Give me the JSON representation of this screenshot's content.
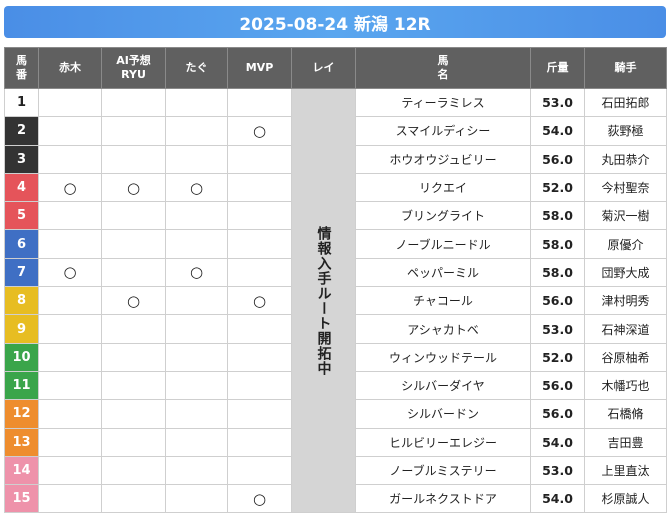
{
  "header": {
    "title": "2025-08-24 新潟 12R"
  },
  "columns": {
    "umaban": "馬\n番",
    "akagi": "赤木",
    "ai": "AI予想\nRYU",
    "tagu": "たぐ",
    "mvp": "MVP",
    "rei": "レイ",
    "bamei": "馬\n名",
    "kinryo": "斤量",
    "kishu": "騎手"
  },
  "rei_note": "情報入手ルート開拓中",
  "mark_symbol": "○",
  "rows": [
    {
      "num": "1",
      "color": "#ffffff",
      "text": "#222222",
      "akagi": "",
      "ai": "",
      "tagu": "",
      "mvp": "",
      "name": "ティーラミレス",
      "weight": "53.0",
      "jockey": "石田拓郎"
    },
    {
      "num": "2",
      "color": "#333333",
      "text": "#ffffff",
      "akagi": "",
      "ai": "",
      "tagu": "",
      "mvp": "○",
      "name": "スマイルディシー",
      "weight": "54.0",
      "jockey": "荻野極"
    },
    {
      "num": "3",
      "color": "#333333",
      "text": "#ffffff",
      "akagi": "",
      "ai": "",
      "tagu": "",
      "mvp": "",
      "name": "ホウオウジュビリー",
      "weight": "56.0",
      "jockey": "丸田恭介"
    },
    {
      "num": "4",
      "color": "#e5545a",
      "text": "#ffffff",
      "akagi": "○",
      "ai": "○",
      "tagu": "○",
      "mvp": "",
      "name": "リクエイ",
      "weight": "52.0",
      "jockey": "今村聖奈"
    },
    {
      "num": "5",
      "color": "#e5545a",
      "text": "#ffffff",
      "akagi": "",
      "ai": "",
      "tagu": "",
      "mvp": "",
      "name": "ブリングライト",
      "weight": "58.0",
      "jockey": "菊沢一樹"
    },
    {
      "num": "6",
      "color": "#3f6fc4",
      "text": "#ffffff",
      "akagi": "",
      "ai": "",
      "tagu": "",
      "mvp": "",
      "name": "ノーブルニードル",
      "weight": "58.0",
      "jockey": "原優介"
    },
    {
      "num": "7",
      "color": "#3f6fc4",
      "text": "#ffffff",
      "akagi": "○",
      "ai": "",
      "tagu": "○",
      "mvp": "",
      "name": "ペッパーミル",
      "weight": "58.0",
      "jockey": "団野大成"
    },
    {
      "num": "8",
      "color": "#e7bd22",
      "text": "#ffffff",
      "akagi": "",
      "ai": "○",
      "tagu": "",
      "mvp": "○",
      "name": "チャコール",
      "weight": "56.0",
      "jockey": "津村明秀"
    },
    {
      "num": "9",
      "color": "#e7bd22",
      "text": "#ffffff",
      "akagi": "",
      "ai": "",
      "tagu": "",
      "mvp": "",
      "name": "アシャカトベ",
      "weight": "53.0",
      "jockey": "石神深道"
    },
    {
      "num": "10",
      "color": "#3aa54a",
      "text": "#ffffff",
      "akagi": "",
      "ai": "",
      "tagu": "",
      "mvp": "",
      "name": "ウィンウッドテール",
      "weight": "52.0",
      "jockey": "谷原柚希"
    },
    {
      "num": "11",
      "color": "#3aa54a",
      "text": "#ffffff",
      "akagi": "",
      "ai": "",
      "tagu": "",
      "mvp": "",
      "name": "シルバーダイヤ",
      "weight": "56.0",
      "jockey": "木幡巧也"
    },
    {
      "num": "12",
      "color": "#ee8d2e",
      "text": "#ffffff",
      "akagi": "",
      "ai": "",
      "tagu": "",
      "mvp": "",
      "name": "シルバードン",
      "weight": "56.0",
      "jockey": "石橋脩"
    },
    {
      "num": "13",
      "color": "#ee8d2e",
      "text": "#ffffff",
      "akagi": "",
      "ai": "",
      "tagu": "",
      "mvp": "",
      "name": "ヒルビリーエレジー",
      "weight": "54.0",
      "jockey": "吉田豊"
    },
    {
      "num": "14",
      "color": "#ee92aa",
      "text": "#ffffff",
      "akagi": "",
      "ai": "",
      "tagu": "",
      "mvp": "",
      "name": "ノーブルミステリー",
      "weight": "53.0",
      "jockey": "上里直汰"
    },
    {
      "num": "15",
      "color": "#ee92aa",
      "text": "#ffffff",
      "akagi": "",
      "ai": "",
      "tagu": "",
      "mvp": "○",
      "name": "ガールネクストドア",
      "weight": "54.0",
      "jockey": "杉原誠人"
    }
  ]
}
